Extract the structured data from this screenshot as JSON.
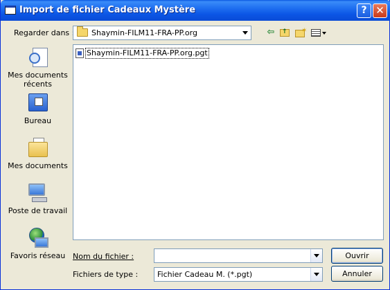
{
  "window": {
    "title": "Import de fichier Cadeaux Mystère",
    "help_label": "?",
    "close_label": "✕"
  },
  "lookin": {
    "label": "Regarder dans :",
    "value": "Shaymin-FILM11-FRA-PP.org"
  },
  "places": [
    {
      "label": "Mes documents récents",
      "icon": "recent-documents-icon"
    },
    {
      "label": "Bureau",
      "icon": "desktop-icon"
    },
    {
      "label": "Mes documents",
      "icon": "my-documents-icon"
    },
    {
      "label": "Poste de travail",
      "icon": "my-computer-icon"
    },
    {
      "label": "Favoris réseau",
      "icon": "network-places-icon"
    }
  ],
  "files": [
    {
      "name": "Shaymin-FILM11-FRA-PP.org.pgt"
    }
  ],
  "filename": {
    "label": "Nom du fichier :",
    "value": ""
  },
  "filetype": {
    "label": "Fichiers de type :",
    "value": "Fichier Cadeau M. (*.pgt)"
  },
  "buttons": {
    "open": "Ouvrir",
    "cancel": "Annuler"
  },
  "colors": {
    "titlebar": "#0a58e2",
    "dialog_bg": "#ece9d8",
    "field_border": "#7f9db9"
  }
}
